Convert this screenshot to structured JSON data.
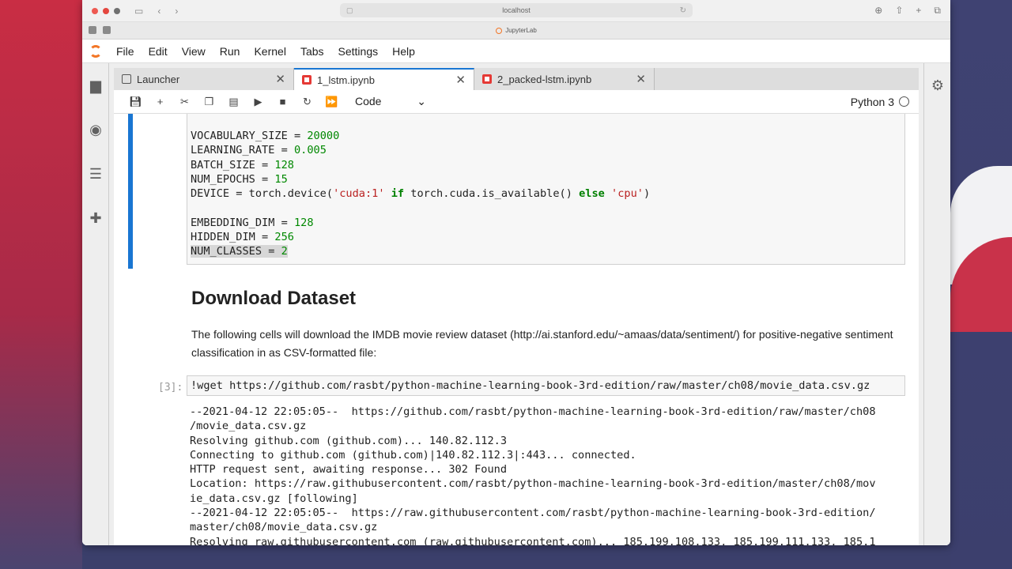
{
  "browser": {
    "address": "localhost",
    "tab_site": "JupyterLab"
  },
  "menu": {
    "items": [
      "File",
      "Edit",
      "View",
      "Run",
      "Kernel",
      "Tabs",
      "Settings",
      "Help"
    ]
  },
  "tabs": [
    {
      "label": "Launcher",
      "active": false
    },
    {
      "label": "1_lstm.ipynb",
      "active": true
    },
    {
      "label": "2_packed-lstm.ipynb",
      "active": false
    }
  ],
  "toolbar": {
    "cell_type": "Code",
    "kernel": "Python 3"
  },
  "cell_settings": {
    "lines": [
      "VOCABULARY_SIZE = 20000",
      "LEARNING_RATE = 0.005",
      "BATCH_SIZE = 128",
      "NUM_EPOCHS = 15",
      "DEVICE = torch.device('cuda:1' if torch.cuda.is_available() else 'cpu')",
      "",
      "EMBEDDING_DIM = 128",
      "HIDDEN_DIM = 256",
      "NUM_CLASSES = 2"
    ]
  },
  "markdown": {
    "heading": "Download Dataset",
    "paragraph": "The following cells will download the IMDB movie review dataset (http://ai.stanford.edu/~amaas/data/sentiment/) for positive-negative sentiment classification in as CSV-formatted file:"
  },
  "cell3": {
    "prompt": "[3]:",
    "code": "!wget https://github.com/rasbt/python-machine-learning-book-3rd-edition/raw/master/ch08/movie_data.csv.gz",
    "output": "--2021-04-12 22:05:05--  https://github.com/rasbt/python-machine-learning-book-3rd-edition/raw/master/ch08\n/movie_data.csv.gz\nResolving github.com (github.com)... 140.82.112.3\nConnecting to github.com (github.com)|140.82.112.3|:443... connected.\nHTTP request sent, awaiting response... 302 Found\nLocation: https://raw.githubusercontent.com/rasbt/python-machine-learning-book-3rd-edition/master/ch08/mov\nie_data.csv.gz [following]\n--2021-04-12 22:05:05--  https://raw.githubusercontent.com/rasbt/python-machine-learning-book-3rd-edition/\nmaster/ch08/movie_data.csv.gz\nResolving raw.githubusercontent.com (raw.githubusercontent.com)... 185.199.108.133, 185.199.111.133, 185.1"
  }
}
